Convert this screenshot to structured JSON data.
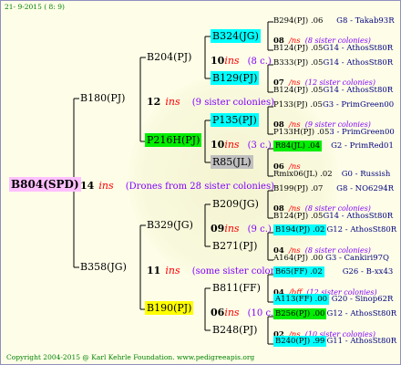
{
  "header": {
    "date": "21- 9-2015 ( 8: 9)"
  },
  "footer": {
    "copyright": "Copyright 2004-2015 @ Karl Kehrle Foundation.   www.pedigreeapis.org"
  },
  "root": {
    "code": "B804(SPD)",
    "num": "14",
    "ins": "ins",
    "note": "(Drones from 28 sister colonies)"
  },
  "gen1": {
    "top": {
      "code": "B180(PJ)",
      "num": "12",
      "ins": "ins",
      "note": "(9 sister colonies)"
    },
    "bottom": {
      "code": "B358(JG)",
      "num": "11",
      "ins": "ins",
      "note": "(some sister colonies)"
    }
  },
  "gen2": {
    "a": {
      "code": "B204(PJ)",
      "num": "10",
      "ins": "ins",
      "note": "(8 c.)"
    },
    "b": {
      "code": "P216H(PJ)",
      "num": "10",
      "ins": "ins",
      "note": "(3 c.)"
    },
    "c": {
      "code": "B329(JG)",
      "num": "09",
      "ins": "ins",
      "note": "(9 c.)"
    },
    "d": {
      "code": "B190(PJ)",
      "num": "06",
      "ins": "ins",
      "note": "(10 c.)"
    }
  },
  "gen3": [
    {
      "code": "B324(JG)"
    },
    {
      "code": "B129(PJ)"
    },
    {
      "code": "P135(PJ)"
    },
    {
      "code": "R85(JL)"
    },
    {
      "code": "B209(JG)"
    },
    {
      "code": "B271(PJ)"
    },
    {
      "code": "B811(FF)"
    },
    {
      "code": "B248(PJ)"
    }
  ],
  "gen4": [
    {
      "top": {
        "code": "B294(PJ)",
        "num": ".06",
        "ref": "G8 - Takab93R"
      },
      "mid": {
        "num": "08",
        "ins": "/ns",
        "note": "(8 sister colonies)"
      },
      "bot": {
        "code": "B124(PJ)",
        "num": ".05",
        "ref": "G14 - AthosSt80R"
      }
    },
    {
      "top": {
        "code": "B333(PJ)",
        "num": ".05",
        "ref": "G14 - AthosSt80R"
      },
      "mid": {
        "num": "07",
        "ins": "/ns",
        "note": "(12 sister colonies)"
      },
      "bot": {
        "code": "B124(PJ)",
        "num": ".05",
        "ref": "G14 - AthosSt80R"
      }
    },
    {
      "top": {
        "code": "P133(PJ)",
        "num": ".05",
        "ref": "G3 - PrimGreen00"
      },
      "mid": {
        "num": "08",
        "ins": "/ns",
        "note": "(9 sister colonies)"
      },
      "bot": {
        "code": "P133H(PJ)",
        "num": ".05",
        "ref": "3 - PrimGreen00"
      }
    },
    {
      "top": {
        "code": "R84(JL)",
        "num": ".04",
        "ref": "G2 - PrimRed01"
      },
      "mid": {
        "num": "06",
        "ins": "/ns",
        "note": ""
      },
      "bot": {
        "code": "Rmix06(JL)",
        "num": ".02",
        "ref": "G0 - Russish"
      }
    },
    {
      "top": {
        "code": "B199(PJ)",
        "num": ".07",
        "ref": "G8 - NO6294R"
      },
      "mid": {
        "num": "08",
        "ins": "/ns",
        "note": "(8 sister colonies)"
      },
      "bot": {
        "code": "B124(PJ)",
        "num": ".05",
        "ref": "G14 - AthosSt80R"
      }
    },
    {
      "top": {
        "code": "B194(PJ)",
        "num": ".02",
        "ref": "G12 - AthosSt80R"
      },
      "mid": {
        "num": "04",
        "ins": "/ns",
        "note": "(8 sister colonies)"
      },
      "bot": {
        "code": "A164(PJ)",
        "num": ".00",
        "ref": "G3 - Cankiri97Q"
      }
    },
    {
      "top": {
        "code": "B65(FF)",
        "num": ".02",
        "ref": "G26 - B-xx43"
      },
      "mid": {
        "num": "04",
        "ins": "/bff",
        "note": "(12 sister colonies)"
      },
      "bot": {
        "code": "A113(FF)",
        "num": ".00",
        "ref": "G20 - Sinop62R"
      }
    },
    {
      "top": {
        "code": "B256(PJ)",
        "num": ".00",
        "ref": "G12 - AthosSt80R"
      },
      "mid": {
        "num": "02",
        "ins": "/ns",
        "note": "(10 sister colonies)"
      },
      "bot": {
        "code": "B240(PJ)",
        "num": ".99",
        "ref": "G11 - AthosSt80R"
      }
    }
  ]
}
